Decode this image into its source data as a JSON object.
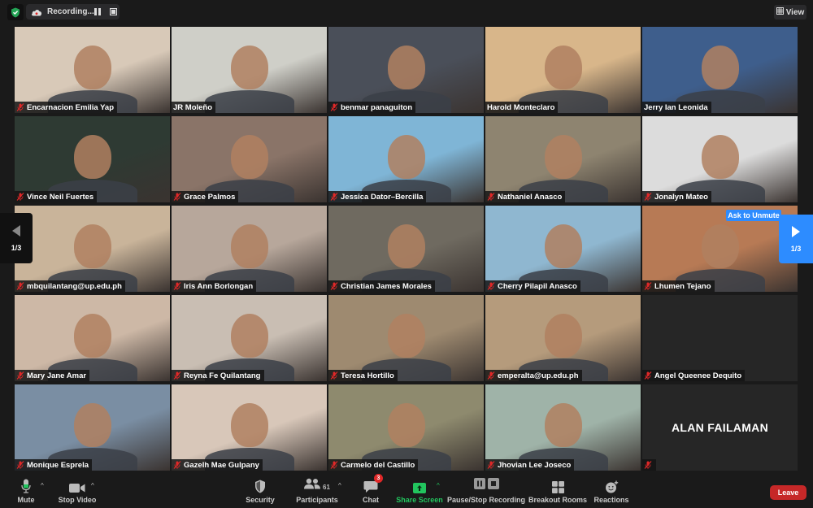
{
  "top_bar": {
    "security_icon": "shield-check-icon",
    "recording_label": "Recording...",
    "view_label": "View"
  },
  "colors": {
    "active_speaker": "#c9e06b",
    "accent_blue": "#2d8cff",
    "share_green": "#22c55e",
    "leave_red": "#c62828",
    "muted_red": "#e02828"
  },
  "gallery": {
    "page_indicator": "1/3",
    "ask_to_unmute": "Ask to Unmute",
    "participants": [
      {
        "name": "Encarnacion Emilia Yap",
        "muted": true,
        "video": true,
        "bg": "#d8c9b8"
      },
      {
        "name": "JR Moleño",
        "muted": false,
        "video": true,
        "active": true,
        "bg": "#cfcfc8"
      },
      {
        "name": "benmar panaguiton",
        "muted": true,
        "video": true,
        "bg": "#4a4f59"
      },
      {
        "name": "Harold Monteclaro",
        "muted": false,
        "video": true,
        "bg": "#d8b68a"
      },
      {
        "name": "Jerry Ian Leonida",
        "muted": false,
        "video": true,
        "bg": "#3e5e8c"
      },
      {
        "name": "Vince Neil Fuertes",
        "muted": true,
        "video": true,
        "bg": "#2e3a33"
      },
      {
        "name": "Grace Palmos",
        "muted": true,
        "video": true,
        "bg": "#8a7468"
      },
      {
        "name": "Jessica Dator–Bercilla",
        "muted": true,
        "video": true,
        "bg": "#7fb5d6"
      },
      {
        "name": "Nathaniel Anasco",
        "muted": true,
        "video": true,
        "bg": "#8e8470"
      },
      {
        "name": "Jonalyn Mateo",
        "muted": true,
        "video": true,
        "bg": "#dcdcdc"
      },
      {
        "name": "mbquilantang@up.edu.ph",
        "muted": true,
        "video": true,
        "bg": "#c9b49a"
      },
      {
        "name": "Iris Ann Borlongan",
        "muted": true,
        "video": true,
        "bg": "#b7a79b"
      },
      {
        "name": "Christian James Morales",
        "muted": true,
        "video": true,
        "bg": "#6f6a60"
      },
      {
        "name": "Cherry Pilapil Anasco",
        "muted": true,
        "video": true,
        "bg": "#8fb7d0"
      },
      {
        "name": "Lhumen Tejano",
        "muted": true,
        "video": true,
        "bg": "#b77a55"
      },
      {
        "name": "Mary Jane Amar",
        "muted": true,
        "video": true,
        "bg": "#cdb8a6"
      },
      {
        "name": "Reyna Fe Quilantang",
        "muted": true,
        "video": true,
        "bg": "#c9beb3"
      },
      {
        "name": "Teresa Hortillo",
        "muted": true,
        "video": true,
        "bg": "#9e8a70"
      },
      {
        "name": "emperalta@up.edu.ph",
        "muted": true,
        "video": true,
        "bg": "#b59b7c"
      },
      {
        "name": "Angel Queenee Dequito",
        "muted": true,
        "video": false,
        "bg": "#262626"
      },
      {
        "name": "Monique Esprela",
        "muted": true,
        "video": true,
        "bg": "#7a8ea3"
      },
      {
        "name": "Gazelh Mae Gulpany",
        "muted": true,
        "video": true,
        "bg": "#d8c7b9"
      },
      {
        "name": "Carmelo del Castillo",
        "muted": true,
        "video": true,
        "bg": "#8e8a6e"
      },
      {
        "name": "Jhovian Lee Joseco",
        "muted": true,
        "video": true,
        "bg": "#9fb3a8"
      },
      {
        "name": "",
        "display_name": "ALAN FAILAMAN",
        "muted": true,
        "video": false,
        "bg": "#262626"
      }
    ]
  },
  "toolbar": {
    "mute": "Mute",
    "stop_video": "Stop Video",
    "security": "Security",
    "participants": "Participants",
    "participants_count": "61",
    "chat": "Chat",
    "chat_badge": "3",
    "share_screen": "Share Screen",
    "pause_stop_recording": "Pause/Stop Recording",
    "breakout_rooms": "Breakout Rooms",
    "reactions": "Reactions",
    "leave": "Leave"
  }
}
